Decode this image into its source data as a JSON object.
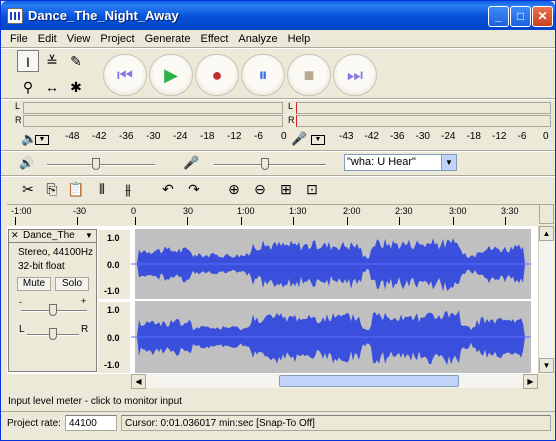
{
  "window": {
    "title": "Dance_The_Night_Away",
    "minimize_glyph": "_",
    "maximize_glyph": "□",
    "close_glyph": "✕"
  },
  "menubar": {
    "items": [
      "File",
      "Edit",
      "View",
      "Project",
      "Generate",
      "Effect",
      "Analyze",
      "Help"
    ]
  },
  "tools": {
    "selection": "I",
    "envelope": "≚",
    "draw": "✎",
    "zoom": "⚲",
    "timeshift": "↔",
    "multi": "✱"
  },
  "transport": {
    "skip_start": "⏮",
    "play": "▶",
    "record": "●",
    "pause": "⏸",
    "stop": "■",
    "skip_end": "⏭",
    "colors": {
      "skip": "#8a78e8",
      "play": "#2fb14a",
      "record": "#c03030",
      "pause": "#3a6fe0",
      "stop": "#b8a890"
    }
  },
  "meters": {
    "playback": {
      "L": "L",
      "R": "R"
    },
    "record": {
      "L": "L",
      "R": "R"
    },
    "playback_scale": [
      "-48",
      "-42",
      "-36",
      "-30",
      "-24",
      "-18",
      "-12",
      "-6",
      "0"
    ],
    "record_scale": [
      "-43",
      "-42",
      "-36",
      "-30",
      "-24",
      "-18",
      "-12",
      "-6",
      "0"
    ]
  },
  "mixer": {
    "speaker_icon": "🔊",
    "mic_icon": "🎤",
    "input_source": "\"wha: U Hear\"",
    "output_volume": 0.45,
    "input_volume": 0.45
  },
  "edit_toolbar": {
    "cut": "✂",
    "copy": "⎘",
    "paste": "📋",
    "trim": "⫴",
    "silence": "⫵",
    "undo": "↶",
    "redo": "↷",
    "zoom_in": "⊕",
    "zoom_out": "⊖",
    "fit_selection": "⊞",
    "fit_project": "⊡"
  },
  "timeline": {
    "labels": [
      "-1:00",
      "-30",
      "0",
      "30",
      "1:00",
      "1:30",
      "2:00",
      "2:30",
      "3:00",
      "3:30"
    ]
  },
  "track": {
    "close": "✕",
    "name": "Dance_The",
    "dropdown": "▼",
    "format": "Stereo, 44100Hz",
    "bit_depth": "32-bit float",
    "mute": "Mute",
    "solo": "Solo",
    "gain_minus": "-",
    "gain_plus": "+",
    "pan_left": "L",
    "pan_right": "R",
    "channel_scale": [
      "1.0",
      "0.0",
      "-1.0"
    ],
    "waveform_color": "#3a4fdc"
  },
  "status": {
    "message": "Input level meter - click to monitor input",
    "project_rate_label": "Project rate:",
    "project_rate": "44100",
    "cursor": "Cursor: 0:01.036017 min:sec   [Snap-To Off]"
  }
}
